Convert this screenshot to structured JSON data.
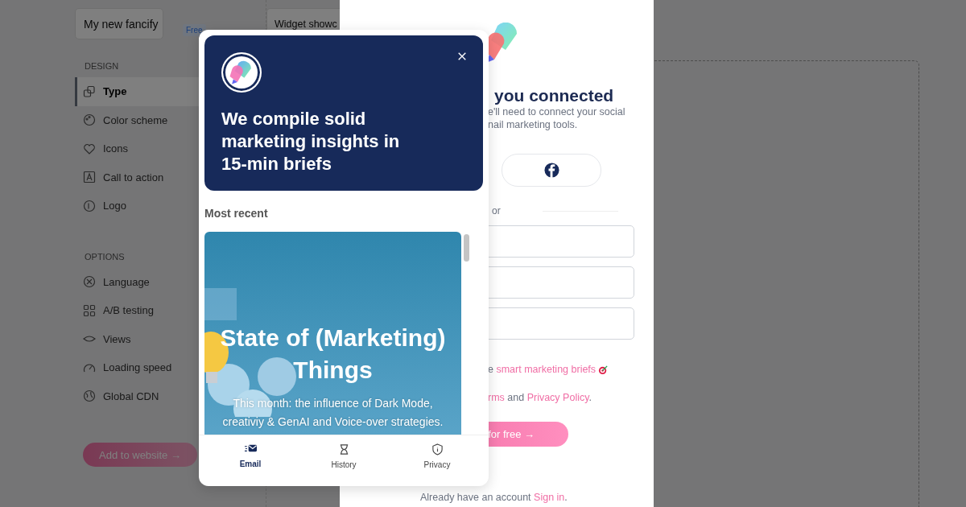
{
  "app": {
    "project_name": "My new fancify",
    "plan_badge": "Free",
    "tab": "Widget showc",
    "sections": [
      {
        "title": "DESIGN",
        "items": [
          {
            "label": "Type",
            "selected": true
          },
          {
            "label": "Color scheme",
            "selected": false
          },
          {
            "label": "Icons",
            "selected": false
          },
          {
            "label": "Call to action",
            "selected": false
          },
          {
            "label": "Logo",
            "selected": false
          }
        ]
      },
      {
        "title": "OPTIONS",
        "items": [
          {
            "label": "Language",
            "selected": false
          },
          {
            "label": "A/B testing",
            "selected": false
          },
          {
            "label": "Views",
            "selected": false
          },
          {
            "label": "Loading speed",
            "selected": false
          },
          {
            "label": "Global CDN",
            "selected": false
          }
        ]
      }
    ],
    "add_button": "Add to website →"
  },
  "signup": {
    "heading": "you connected",
    "subtitle_lines": [
      "e'll need to connect your social",
      "nail marketing tools."
    ],
    "divider_text": "or",
    "consent": {
      "before": "e ",
      "link": "smart marketing briefs"
    },
    "terms": {
      "link": "rms",
      "middle": " and ",
      "link2": "Privacy Policy",
      "after": "."
    },
    "cta": "for free →",
    "signin": {
      "before": "Already have an account ",
      "link": "Sign in",
      "after": "."
    }
  },
  "widget": {
    "title": "We compile solid marketing insights in 15-min briefs",
    "section_title": "Most recent",
    "card": {
      "title": "State of (Marketing) Things",
      "subtitle": "This month: the influence of Dark Mode, creativiy & GenAI and Voice-over strategies."
    },
    "nav": [
      {
        "label": "Email",
        "selected": true
      },
      {
        "label": "History",
        "selected": false
      },
      {
        "label": "Privacy",
        "selected": false
      }
    ]
  }
}
